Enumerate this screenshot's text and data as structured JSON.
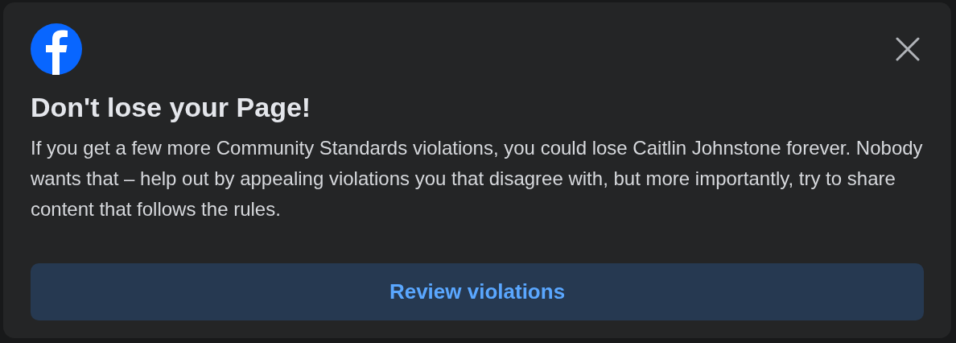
{
  "dialog": {
    "title": "Don't lose your Page!",
    "message": "If you get a few more Community Standards violations, you could lose Caitlin Johnstone forever. Nobody wants that – help out by appealing violations you that disagree with, but more importantly, try to share content that follows the rules.",
    "button": {
      "label": "Review violations"
    }
  }
}
